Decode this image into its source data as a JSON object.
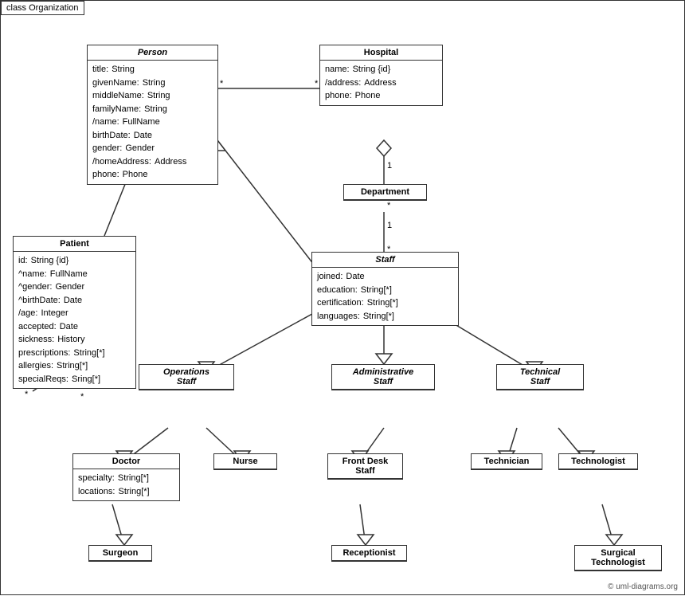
{
  "diagram": {
    "title": "class Organization",
    "copyright": "© uml-diagrams.org",
    "boxes": {
      "person": {
        "label": "Person",
        "italic": true,
        "attrs": [
          [
            "title:",
            "String"
          ],
          [
            "givenName:",
            "String"
          ],
          [
            "middleName:",
            "String"
          ],
          [
            "familyName:",
            "String"
          ],
          [
            "/name:",
            "FullName"
          ],
          [
            "birthDate:",
            "Date"
          ],
          [
            "gender:",
            "Gender"
          ],
          [
            "/homeAddress:",
            "Address"
          ],
          [
            "phone:",
            "Phone"
          ]
        ]
      },
      "hospital": {
        "label": "Hospital",
        "italic": false,
        "attrs": [
          [
            "name:",
            "String {id}"
          ],
          [
            "/address:",
            "Address"
          ],
          [
            "phone:",
            "Phone"
          ]
        ]
      },
      "department": {
        "label": "Department",
        "italic": false,
        "attrs": []
      },
      "staff": {
        "label": "Staff",
        "italic": true,
        "attrs": [
          [
            "joined:",
            "Date"
          ],
          [
            "education:",
            "String[*]"
          ],
          [
            "certification:",
            "String[*]"
          ],
          [
            "languages:",
            "String[*]"
          ]
        ]
      },
      "patient": {
        "label": "Patient",
        "italic": false,
        "attrs": [
          [
            "id:",
            "String {id}"
          ],
          [
            "^name:",
            "FullName"
          ],
          [
            "^gender:",
            "Gender"
          ],
          [
            "^birthDate:",
            "Date"
          ],
          [
            "/age:",
            "Integer"
          ],
          [
            "accepted:",
            "Date"
          ],
          [
            "sickness:",
            "History"
          ],
          [
            "prescriptions:",
            "String[*]"
          ],
          [
            "allergies:",
            "String[*]"
          ],
          [
            "specialReqs:",
            "Sring[*]"
          ]
        ]
      },
      "ops_staff": {
        "label": "Operations Staff",
        "italic": true,
        "attrs": []
      },
      "admin_staff": {
        "label": "Administrative Staff",
        "italic": true,
        "attrs": []
      },
      "tech_staff": {
        "label": "Technical Staff",
        "italic": true,
        "attrs": []
      },
      "doctor": {
        "label": "Doctor",
        "italic": false,
        "attrs": [
          [
            "specialty:",
            "String[*]"
          ],
          [
            "locations:",
            "String[*]"
          ]
        ]
      },
      "nurse": {
        "label": "Nurse",
        "italic": false,
        "attrs": []
      },
      "front_desk": {
        "label": "Front Desk Staff",
        "italic": false,
        "attrs": []
      },
      "technician": {
        "label": "Technician",
        "italic": false,
        "attrs": []
      },
      "technologist": {
        "label": "Technologist",
        "italic": false,
        "attrs": []
      },
      "surgeon": {
        "label": "Surgeon",
        "italic": false,
        "attrs": []
      },
      "receptionist": {
        "label": "Receptionist",
        "italic": false,
        "attrs": []
      },
      "surgical_tech": {
        "label": "Surgical Technologist",
        "italic": false,
        "attrs": []
      }
    }
  }
}
